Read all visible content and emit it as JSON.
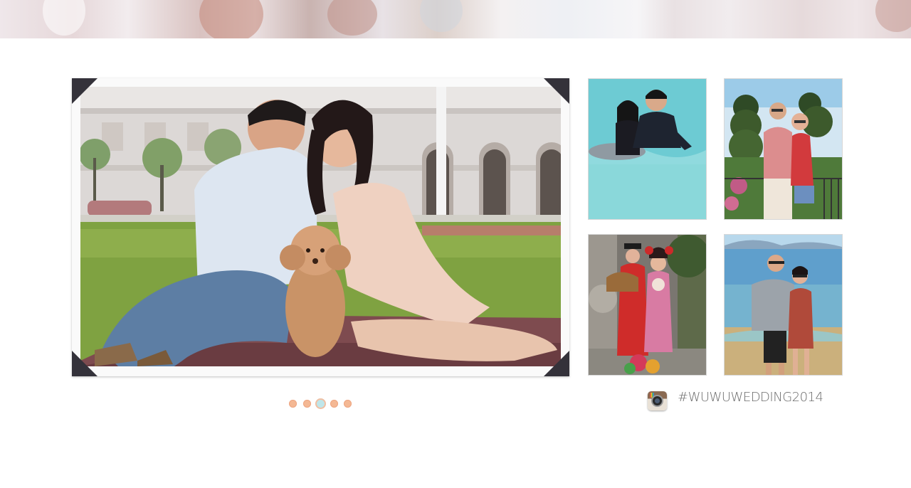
{
  "slideshow": {
    "photo_icon": "couple-with-poodle-photo",
    "dots": [
      {
        "active": false
      },
      {
        "active": false
      },
      {
        "active": true
      },
      {
        "active": false
      },
      {
        "active": false
      }
    ]
  },
  "thumbnails": [
    {
      "icon": "dolphin-swim-photo"
    },
    {
      "icon": "topiary-garden-photo"
    },
    {
      "icon": "costume-photo"
    },
    {
      "icon": "lake-shore-photo"
    }
  ],
  "instagram": {
    "icon": "instagram-icon",
    "hashtag": "#WUWUWEDDING2014"
  },
  "colors": {
    "corner": "#34323a",
    "dot": "#f4b894",
    "dot_active": "#bfe6ea",
    "hashtag": "#6b6b6b"
  }
}
